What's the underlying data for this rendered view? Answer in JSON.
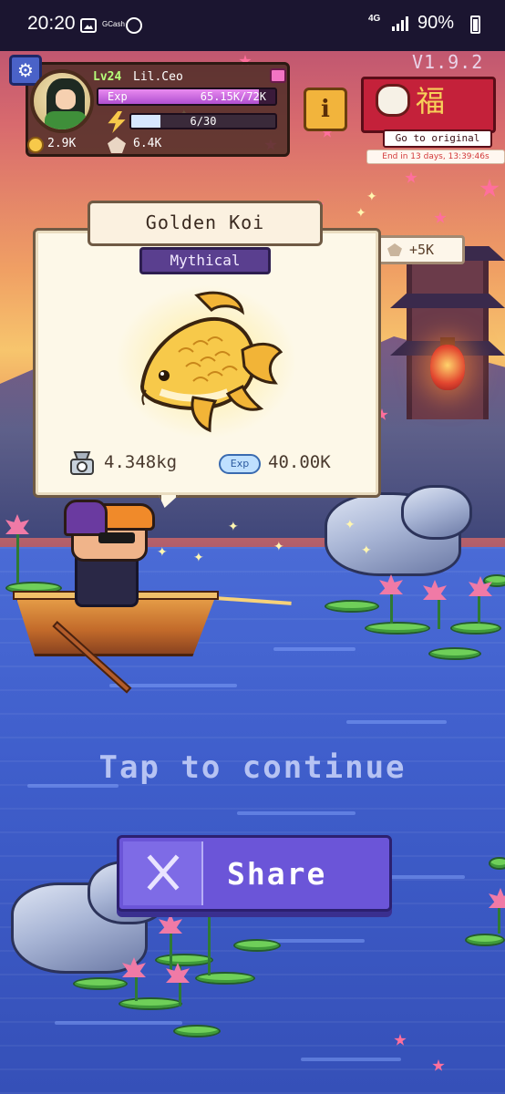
{
  "status_bar": {
    "time": "20:20",
    "app_icon_label": "GCash",
    "network": "4G",
    "battery": "90%"
  },
  "hud": {
    "level": "Lv24",
    "player_name": "Lil.Ceo",
    "exp_label": "Exp",
    "exp_value": "65.15K/72K",
    "exp_fraction": 0.905,
    "energy_value": "6/30",
    "energy_fraction": 0.2,
    "coins": "2.9K",
    "gems": "6.4K",
    "version": "V1.9.2",
    "info_button": "i"
  },
  "event": {
    "glyph": "福",
    "go_label": "Go to original",
    "timer": "End in 13 days, 13:39:46s"
  },
  "reward_chip": "+5K",
  "catch": {
    "fish_name": "Golden Koi",
    "rarity": "Mythical",
    "weight": "4.348kg",
    "exp_badge": "Exp",
    "exp_reward": "40.00K"
  },
  "actions": {
    "tap_to_continue": "Tap to continue",
    "share_label": "Share"
  },
  "colors": {
    "share_button": "#6b55d8",
    "rarity_badge": "#5a3f8f",
    "exp_bar": "#b04fd0",
    "event_banner": "#c4213a"
  }
}
